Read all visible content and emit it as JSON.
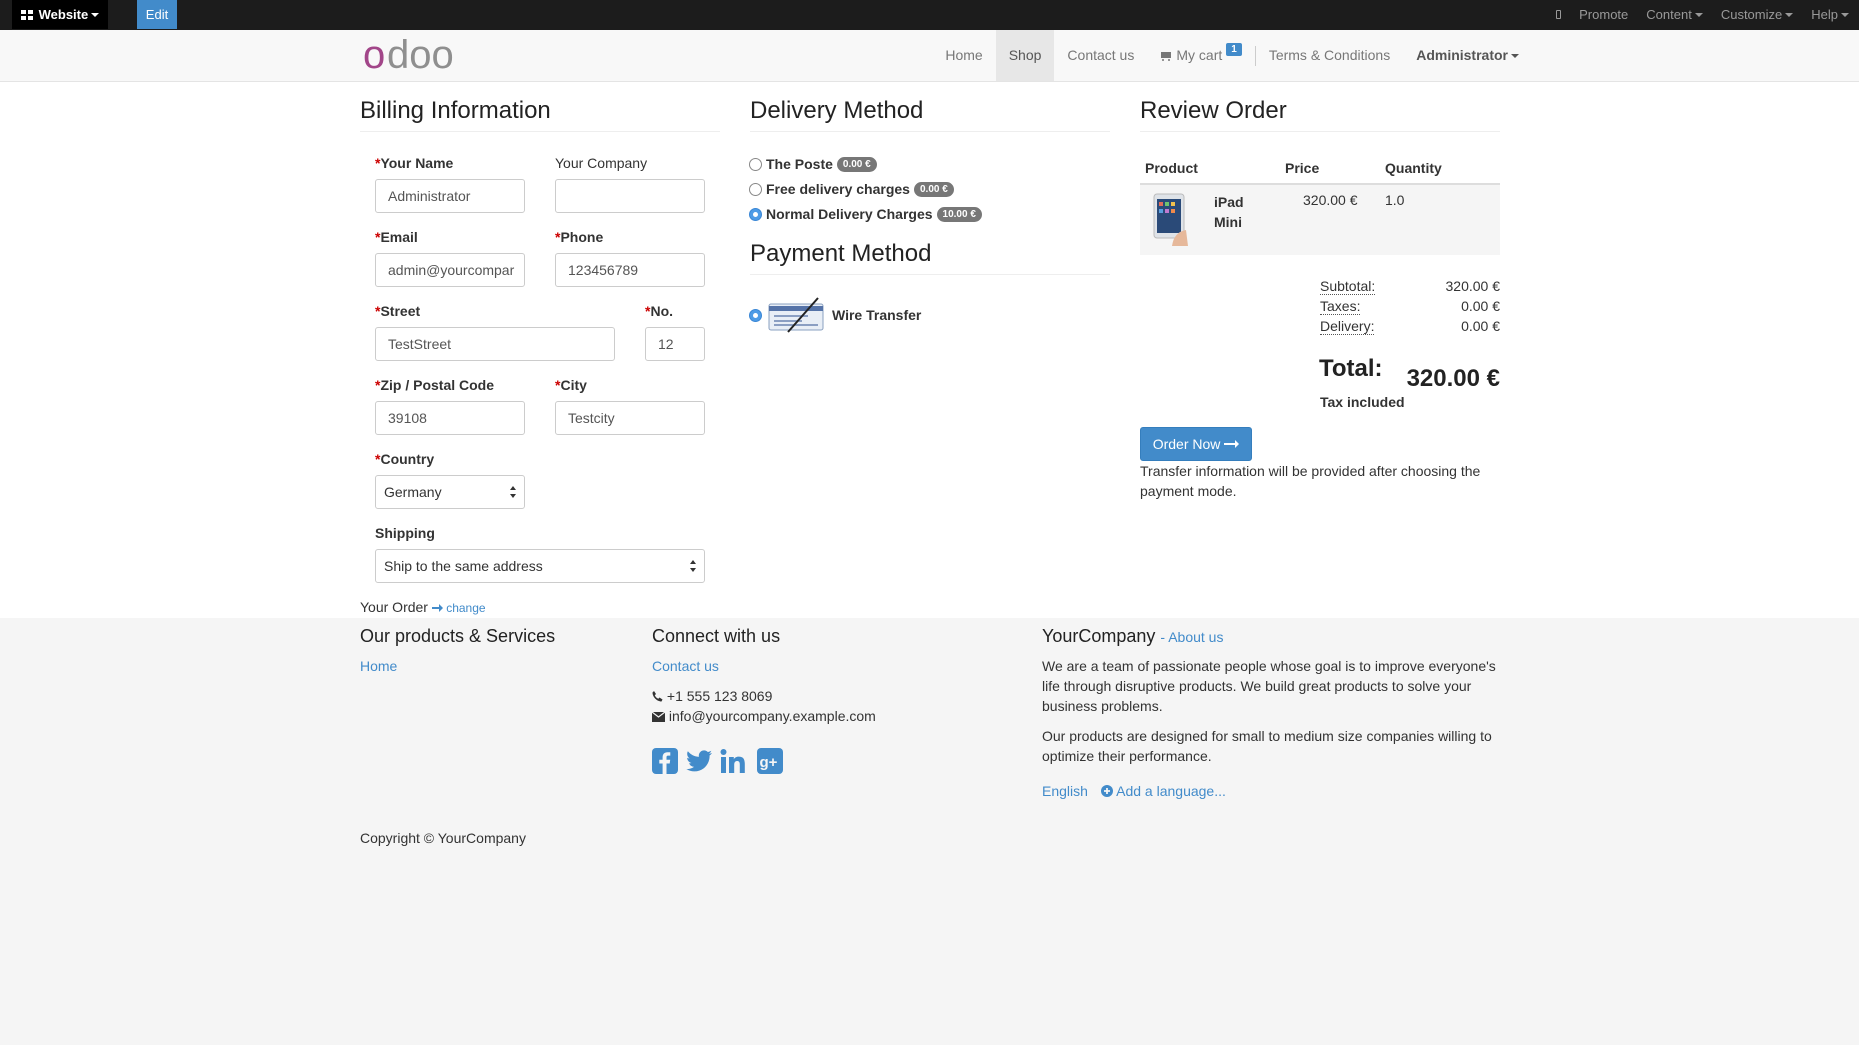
{
  "admin_bar": {
    "website_label": "Website",
    "edit_label": "Edit",
    "menu": [
      "Promote",
      "Content",
      "Customize",
      "Help"
    ]
  },
  "navbar": {
    "logo_text": "odoo",
    "items": [
      "Home",
      "Shop",
      "Contact us"
    ],
    "cart_label": "My cart",
    "cart_count": "1",
    "terms_label": "Terms & Conditions",
    "user_label": "Administrator"
  },
  "billing": {
    "title": "Billing Information",
    "name_label": "Your Name",
    "name_value": "Administrator",
    "company_label": "Your Company",
    "company_value": "",
    "email_label": "Email",
    "email_value": "admin@yourcompar",
    "phone_label": "Phone",
    "phone_value": "123456789",
    "street_label": "Street",
    "street_value": "TestStreet",
    "no_label": "No.",
    "no_value": "12",
    "zip_label": "Zip / Postal Code",
    "zip_value": "39108",
    "city_label": "City",
    "city_value": "Testcity",
    "country_label": "Country",
    "country_value": "Germany",
    "shipping_label": "Shipping",
    "shipping_value": "Ship to the same address",
    "your_order_label": "Your Order",
    "change_label": "change"
  },
  "delivery": {
    "title": "Delivery Method",
    "options": [
      {
        "label": "The Poste",
        "price": "0.00 €",
        "selected": false
      },
      {
        "label": "Free delivery charges",
        "price": "0.00 €",
        "selected": false
      },
      {
        "label": "Normal Delivery Charges",
        "price": "10.00 €",
        "selected": true
      }
    ]
  },
  "payment": {
    "title": "Payment Method",
    "option_label": "Wire Transfer",
    "selected": true
  },
  "review": {
    "title": "Review Order",
    "headers": [
      "Product",
      "Price",
      "Quantity"
    ],
    "product_name_1": "iPad",
    "product_name_2": "Mini",
    "product_price": "320.00 €",
    "product_qty": "1.0",
    "subtotal_label": "Subtotal:",
    "subtotal_value": "320.00 €",
    "taxes_label": "Taxes:",
    "taxes_value": "0.00 €",
    "delivery_label": "Delivery:",
    "delivery_value": "0.00 €",
    "total_label": "Total:",
    "total_value": "320.00 €",
    "tax_included": "Tax included",
    "order_button": "Order Now",
    "transfer_note": "Transfer information will be provided after choosing the payment mode."
  },
  "footer": {
    "products_title": "Our products & Services",
    "products_link": "Home",
    "connect_title": "Connect with us",
    "contact_link": "Contact us",
    "phone": "+1 555 123 8069",
    "email": "info@yourcompany.example.com",
    "company_title": "YourCompany",
    "about_link": "- About us",
    "about_p1": "We are a team of passionate people whose goal is to improve everyone's life through disruptive products. We build great products to solve your business problems.",
    "about_p2": "Our products are designed for small to medium size companies willing to optimize their performance.",
    "lang_current": "English",
    "lang_add": "Add a language...",
    "copyright": "Copyright © YourCompany"
  },
  "colors": {
    "primary": "#428bca",
    "admin_bar": "#1c1c1c",
    "logo_purple": "#a24689",
    "logo_gray": "#8f8f8f"
  }
}
